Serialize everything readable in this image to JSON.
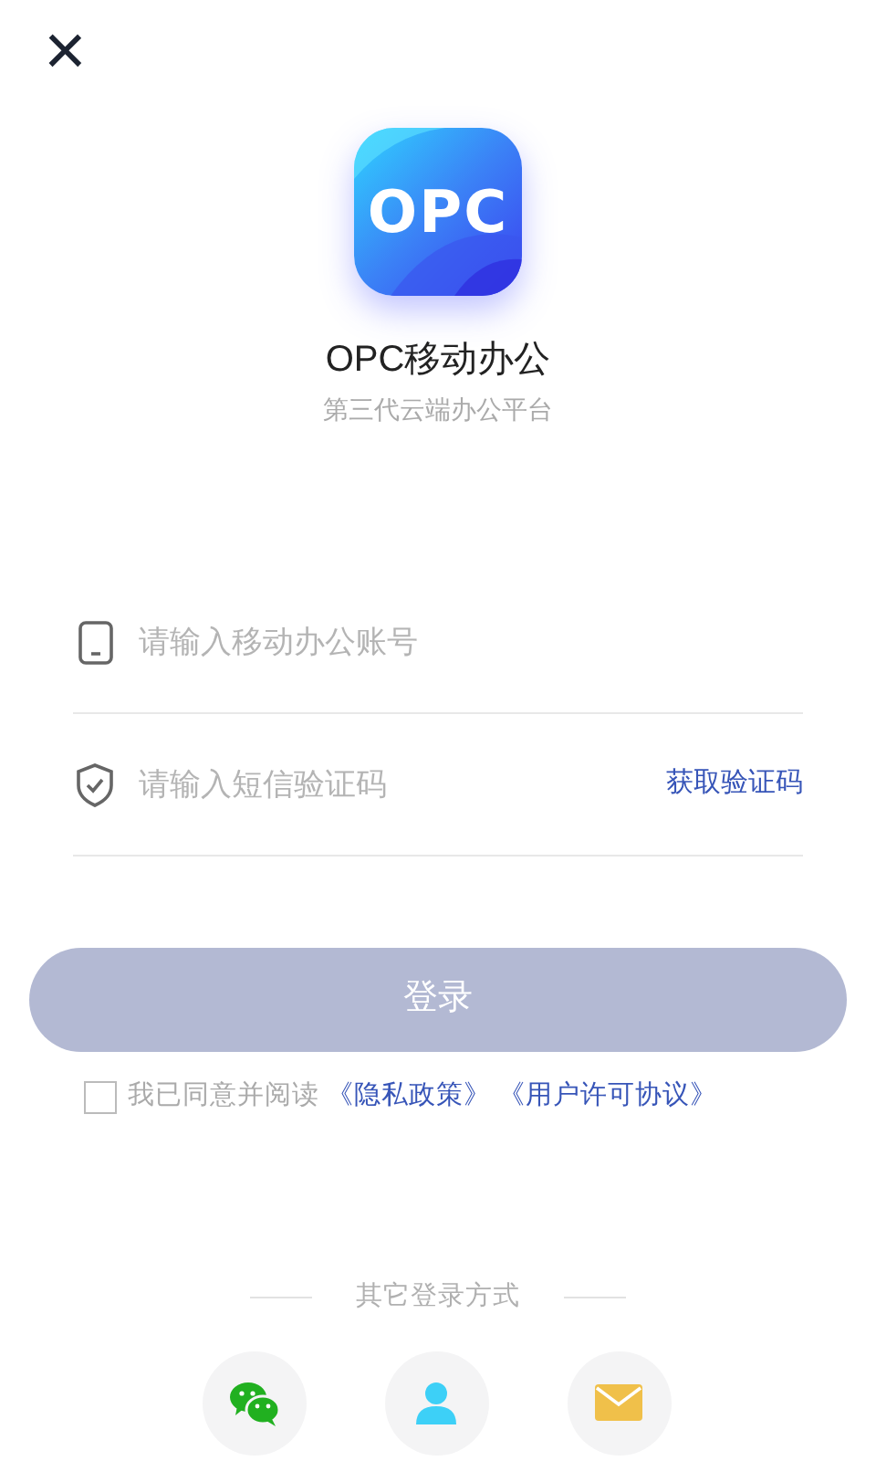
{
  "close_button": {
    "glyph": "×"
  },
  "app": {
    "logo_text": "OPC",
    "name": "OPC移动办公",
    "tagline": "第三代云端办公平台"
  },
  "fields": [
    {
      "kind": "phone",
      "placeholder": "请输入移动办公账号"
    },
    {
      "kind": "code",
      "placeholder": "请输入短信验证码",
      "action": "获取验证码"
    }
  ],
  "login_button": {
    "label": "登录",
    "disabled": true
  },
  "agreement": {
    "checked": false,
    "text": "我已同意并阅读",
    "links": [
      "《隐私政策》",
      "《用户许可协议》"
    ]
  },
  "other_login": {
    "title": "其它登录方式",
    "methods": [
      {
        "kind": "wechat"
      },
      {
        "kind": "account"
      },
      {
        "kind": "mail"
      }
    ]
  }
}
